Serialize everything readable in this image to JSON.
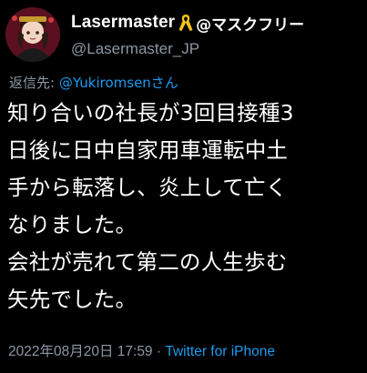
{
  "author": {
    "display_name": "Lasermaster",
    "name_suffix": "@マスクフリー",
    "handle": "@Lasermaster_JP"
  },
  "icons": {
    "avatar": "avatar",
    "ribbon": "yellow-ribbon-icon"
  },
  "reply": {
    "prefix": "返信先: ",
    "target": "@Yukiromsenさん"
  },
  "body": {
    "lines": [
      "知り合いの社長が3回目接種3",
      "日後に日中自家用車運転中土",
      "手から転落し、炎上して亡く",
      "なりました。",
      "会社が売れて第二の人生歩む",
      "矢先でした。"
    ]
  },
  "meta": {
    "timestamp": "2022年08月20日 17:59",
    "separator": " · ",
    "source": "Twitter for iPhone"
  },
  "colors": {
    "background": "#000000",
    "primary_text": "#ffffff",
    "secondary_text": "#8b98a5",
    "link": "#1d9bf0",
    "ribbon": "#f5c518"
  }
}
